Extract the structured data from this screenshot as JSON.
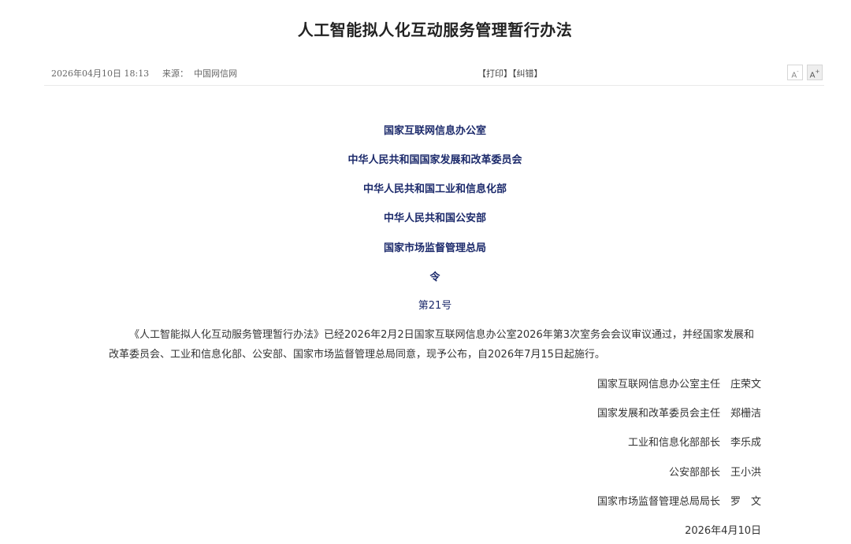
{
  "article": {
    "title": "人工智能拟人化互动服务管理暂行办法",
    "date": "2026年04月10日  18:13",
    "source_label": "来源：",
    "source_value": "中国网信网",
    "print_label": "【打印】",
    "correct_label": "【纠错】",
    "font_decrease": "A",
    "font_increase": "A",
    "font_decrease_mark": "-",
    "font_increase_mark": "+"
  },
  "decree": {
    "issuers": [
      "国家互联网信息办公室",
      "中华人民共和国国家发展和改革委员会",
      "中华人民共和国工业和信息化部",
      "中华人民共和国公安部",
      "国家市场监督管理总局"
    ],
    "order_label": "令",
    "number": "第21号",
    "body": "《人工智能拟人化互动服务管理暂行办法》已经2026年2月2日国家互联网信息办公室2026年第3次室务会会议审议通过，并经国家发展和改革委员会、工业和信息化部、公安部、国家市场监督管理总局同意，现予公布，自2026年7月15日起施行。",
    "signatories": [
      "国家互联网信息办公室主任　庄荣文",
      "国家发展和改革委员会主任　郑栅洁",
      "工业和信息化部部长　李乐成",
      "公安部部长　王小洪",
      "国家市场监督管理总局局长　罗　文"
    ],
    "sign_date": "2026年4月10日"
  },
  "colors": {
    "issuer_text": "#1c2a6b",
    "body_text": "#333333",
    "meta_text": "#666666"
  }
}
